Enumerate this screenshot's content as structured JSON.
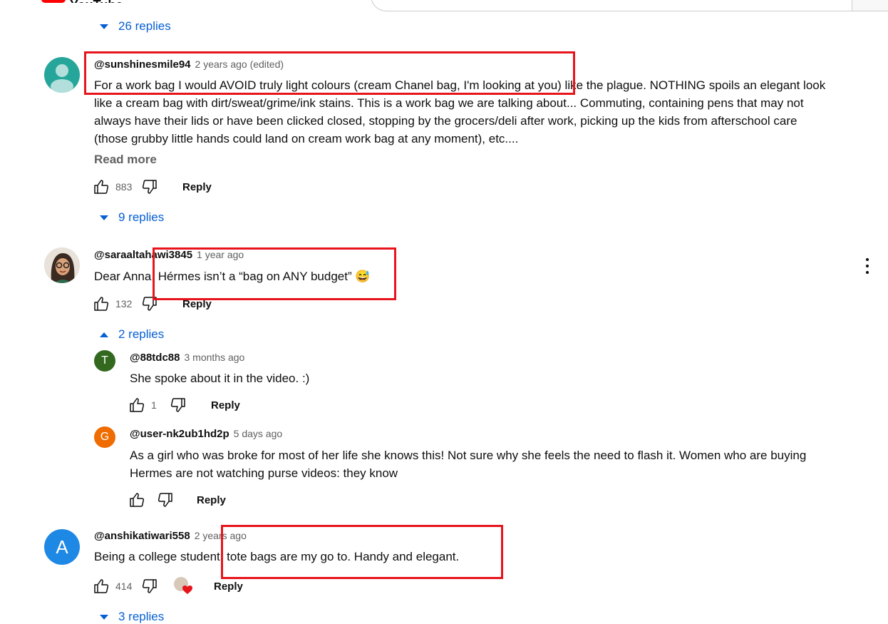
{
  "header": {
    "logo_text": "YouTube"
  },
  "comments": [
    {
      "author": "@sunshinesmile94",
      "meta": "2 years ago (edited)",
      "lines": [
        "For a work bag I would AVOID truly light colours (cream Chanel bag, I'm looking at you) like the plague. NOTHING spoils an elegant look",
        "like a cream bag with dirt/sweat/grime/ink stains. This is a work bag we are talking about... Commuting, containing pens that may not",
        "always have their lids or have been clicked closed, stopping by the grocers/deli after work, picking up the kids from afterschool care",
        "(those grubby little hands could land on cream work bag at any moment), etc...."
      ],
      "read_more": "Read more",
      "likes": "883",
      "reply_label": "Reply",
      "replies_toggle": "9 replies"
    },
    {
      "author": "@saraaltahawi3845",
      "meta": "1 year ago",
      "text": "Dear Anna, Hérmes isn’t a “bag on ANY budget” 😅",
      "likes": "132",
      "reply_label": "Reply",
      "replies_toggle": "2 replies",
      "replies": [
        {
          "avatar_letter": "T",
          "author": "@88tdc88",
          "meta": "3 months ago",
          "text": "She spoke about it in the video. :)",
          "likes": "1",
          "reply_label": "Reply"
        },
        {
          "avatar_letter": "G",
          "author": "@user-nk2ub1hd2p",
          "meta": "5 days ago",
          "lines": [
            "As a girl who was broke for most of her life she knows this! Not sure why she feels the need to flash it. Women who are buying",
            "Hermes are not watching purse videos: they know"
          ],
          "likes": "",
          "reply_label": "Reply"
        }
      ]
    },
    {
      "avatar_letter": "A",
      "author": "@anshikatiwari558",
      "meta": "2 years ago",
      "text": "Being a college student,  tote bags are my go to.  Handy and elegant.",
      "likes": "414",
      "reply_label": "Reply",
      "replies_toggle": "3 replies"
    }
  ],
  "top_replies_toggle": "26 replies",
  "colors": {
    "link_blue": "#065fd4",
    "highlight_red": "#e8141c",
    "avatar_teal": "#26a69a",
    "avatar_green": "#33691e",
    "avatar_orange": "#ef6c00",
    "avatar_blue": "#1e88e5"
  }
}
